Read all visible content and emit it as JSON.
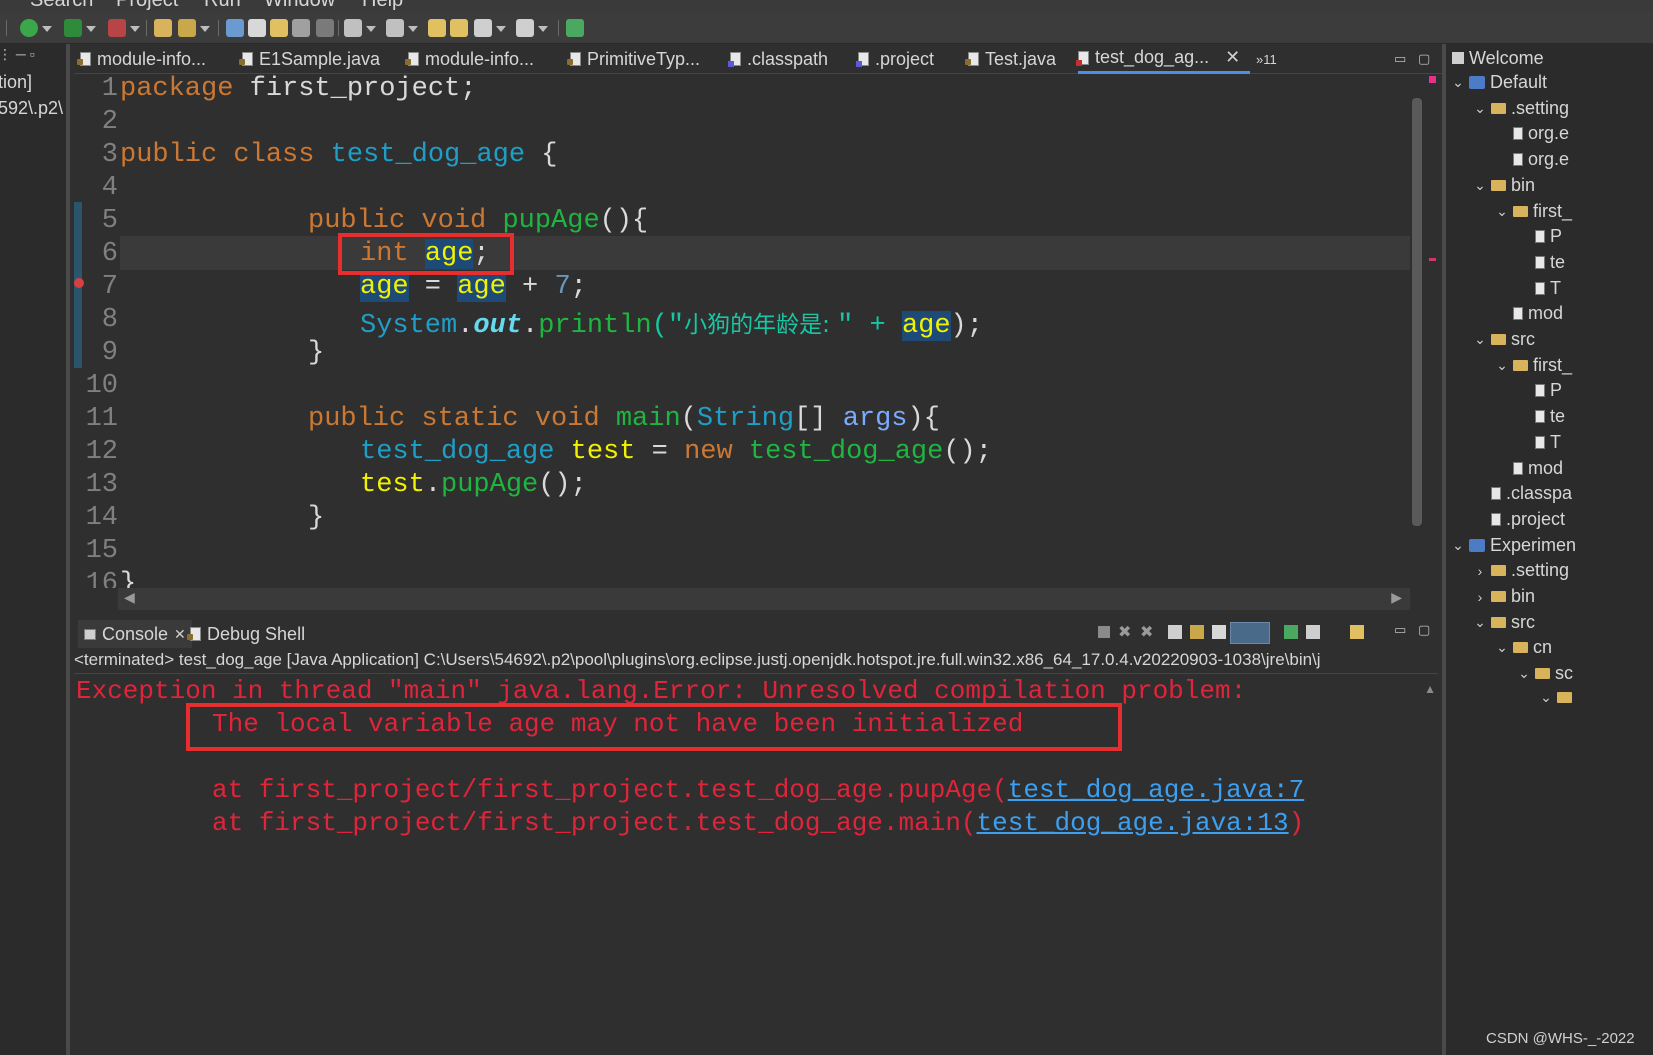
{
  "menubar": {
    "items": [
      "Search",
      "Project",
      "Run",
      "Window",
      "Help"
    ]
  },
  "left_view": {
    "lines": [
      "tion]",
      "592\\.p2\\"
    ]
  },
  "editor_tabs": [
    {
      "label": "module-info...",
      "icon": "module-file-icon"
    },
    {
      "label": "E1Sample.java",
      "icon": "java-file-icon"
    },
    {
      "label": "module-info...",
      "icon": "module-file-icon"
    },
    {
      "label": "PrimitiveTyp...",
      "icon": "java-file-icon"
    },
    {
      "label": ".classpath",
      "icon": "xml-file-icon"
    },
    {
      "label": ".project",
      "icon": "xml-file-icon"
    },
    {
      "label": "Test.java",
      "icon": "java-file-icon"
    },
    {
      "label": "test_dog_ag...",
      "icon": "java-error-file-icon",
      "active": true
    }
  ],
  "more_tabs": "»11",
  "code": {
    "line_numbers": [
      "1",
      "2",
      "3",
      "4",
      "5",
      "6",
      "7",
      "8",
      "9",
      "10",
      "11",
      "12",
      "13",
      "14",
      "15",
      "16"
    ],
    "package_kw": "package",
    "package_name": " first_project;",
    "public_kw": "public",
    "class_kw": "class",
    "class_name": "test_dog_age",
    "brace_open": " {",
    "void_kw": "void",
    "method_name": "pupAge",
    "method_sig": "(){",
    "int_kw": "int",
    "age": "age",
    "semicolon": ";",
    "assign": " = ",
    "plus": " + ",
    "seven": "7",
    "system": "System",
    "dot": ".",
    "out": "out",
    "println": "println",
    "str_open": "(\"",
    "string_literal": "小狗的年龄是: ",
    "str_close": "\" + ",
    "paren_close": ");",
    "brace_close": "}",
    "static_kw": "static",
    "main_name": "main",
    "string_type": "String",
    "brackets": "[] ",
    "args": "args",
    "main_tail": "){",
    "var_test": "test",
    "eq": " = ",
    "new_kw": "new",
    "ctor_tail": "();",
    "call_tail": "();",
    "last_line": "}"
  },
  "console": {
    "tab_label": "Console",
    "tab_close": "✕",
    "debug_tab_label": "Debug Shell",
    "header": "<terminated> test_dog_age [Java Application] C:\\Users\\54692\\.p2\\pool\\plugins\\org.eclipse.justj.openjdk.hotspot.jre.full.win32.x86_64_17.0.4.v20220903-1038\\jre\\bin\\j",
    "lines": [
      "Exception in thread \"main\" java.lang.Error: Unresolved compilation problem: ",
      "The local variable age may not have been initialized",
      "at first_project/first_project.test_dog_age.pupAge(",
      "at first_project/first_project.test_dog_age.main("
    ],
    "links": [
      "test_dog_age.java:7",
      "test_dog_age.java:13"
    ],
    "link_tail": ")"
  },
  "right_view": {
    "title": "Welcome",
    "items": [
      {
        "label": "Default",
        "chev": "⌄",
        "icon": "proj"
      },
      {
        "label": ".setting",
        "chev": "⌄",
        "icon": "folder"
      },
      {
        "label": "org.e",
        "chev": "",
        "icon": "doc"
      },
      {
        "label": "org.e",
        "chev": "",
        "icon": "doc"
      },
      {
        "label": "bin",
        "chev": "⌄",
        "icon": "folder"
      },
      {
        "label": "first_",
        "chev": "⌄",
        "icon": "folder"
      },
      {
        "label": "P",
        "chev": "",
        "icon": "doc"
      },
      {
        "label": "te",
        "chev": "",
        "icon": "doc"
      },
      {
        "label": "T",
        "chev": "",
        "icon": "doc"
      },
      {
        "label": "mod",
        "chev": "",
        "icon": "doc"
      },
      {
        "label": "src",
        "chev": "⌄",
        "icon": "folder"
      },
      {
        "label": "first_",
        "chev": "⌄",
        "icon": "folder"
      },
      {
        "label": "P",
        "chev": "",
        "icon": "doc"
      },
      {
        "label": "te",
        "chev": "",
        "icon": "doc"
      },
      {
        "label": "T",
        "chev": "",
        "icon": "doc"
      },
      {
        "label": "mod",
        "chev": "",
        "icon": "doc"
      },
      {
        "label": ".classpa",
        "chev": "",
        "icon": "doc"
      },
      {
        "label": ".project",
        "chev": "",
        "icon": "doc"
      },
      {
        "label": "Experimen",
        "chev": "⌄",
        "icon": "proj"
      },
      {
        "label": ".setting",
        "chev": "›",
        "icon": "folder"
      },
      {
        "label": "bin",
        "chev": "›",
        "icon": "folder"
      },
      {
        "label": "src",
        "chev": "⌄",
        "icon": "folder"
      },
      {
        "label": "cn",
        "chev": "⌄",
        "icon": "folder"
      },
      {
        "label": "sc",
        "chev": "⌄",
        "icon": "folder"
      },
      {
        "label": "",
        "chev": "⌄",
        "icon": "folder"
      }
    ]
  },
  "watermark": "CSDN @WHS-_-2022",
  "colors": {
    "keyword": "#cc7832",
    "type": "#1f9fc7",
    "error": "#e0243a",
    "highlight_box": "#e62e2e",
    "link": "#3d9ff0"
  }
}
